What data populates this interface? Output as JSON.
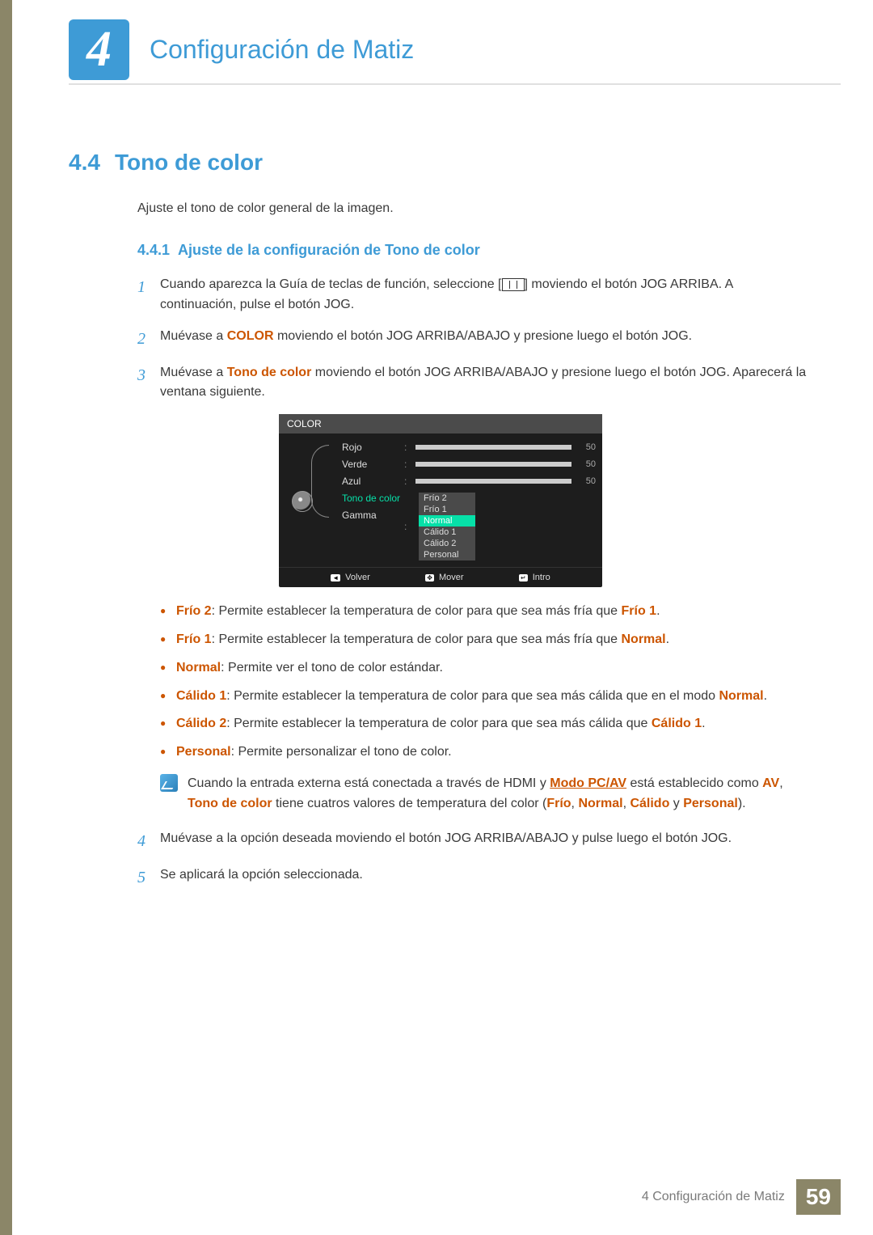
{
  "header": {
    "chapter_number": "4",
    "chapter_title": "Configuración de Matiz"
  },
  "section": {
    "number": "4.4",
    "title": "Tono de color",
    "intro": "Ajuste el tono de color general de la imagen."
  },
  "subsection": {
    "number": "4.4.1",
    "title": "Ajuste de la configuración de Tono de color"
  },
  "steps": {
    "s1": {
      "num": "1",
      "t1": "Cuando aparezca la Guía de teclas de función, seleccione [",
      "t2": "] moviendo el botón JOG ARRIBA. A continuación, pulse el botón JOG."
    },
    "s2": {
      "num": "2",
      "t1": "Muévase a ",
      "k1": "COLOR",
      "t2": " moviendo el botón JOG ARRIBA/ABAJO y presione luego el botón JOG."
    },
    "s3": {
      "num": "3",
      "t1": "Muévase a ",
      "k1": "Tono de color",
      "t2": " moviendo el botón JOG ARRIBA/ABAJO y presione luego el botón JOG. Aparecerá la ventana siguiente."
    },
    "s4": {
      "num": "4",
      "t1": "Muévase a la opción deseada moviendo el botón JOG ARRIBA/ABAJO y pulse luego el botón JOG."
    },
    "s5": {
      "num": "5",
      "t1": "Se aplicará la opción seleccionada."
    }
  },
  "osd": {
    "title": "COLOR",
    "labels": {
      "rojo": "Rojo",
      "verde": "Verde",
      "azul": "Azul",
      "tono": "Tono de color",
      "gamma": "Gamma"
    },
    "values": {
      "rojo": "50",
      "verde": "50",
      "azul": "50"
    },
    "options": {
      "frio2": "Frío 2",
      "frio1": "Frío 1",
      "normal": "Normal",
      "calido1": "Cálido 1",
      "calido2": "Cálido 2",
      "personal": "Personal"
    },
    "footer": {
      "volver": "Volver",
      "mover": "Mover",
      "intro": "Intro",
      "k1": "◄",
      "k2": "✥",
      "k3": "↵"
    }
  },
  "bullets": {
    "b1": {
      "k": "Frío 2",
      "t": ": Permite establecer la temperatura de color para que sea más fría que ",
      "k2": "Frío 1",
      "end": "."
    },
    "b2": {
      "k": "Frío 1",
      "t": ": Permite establecer la temperatura de color para que sea más fría que ",
      "k2": "Normal",
      "end": "."
    },
    "b3": {
      "k": "Normal",
      "t": ": Permite ver el tono de color estándar."
    },
    "b4": {
      "k": "Cálido 1",
      "t": ": Permite establecer la temperatura de color para que sea más cálida que en el modo ",
      "k2": "Normal",
      "end": "."
    },
    "b5": {
      "k": "Cálido 2",
      "t": ": Permite establecer la temperatura de color para que sea más cálida que ",
      "k2": "Cálido 1",
      "end": "."
    },
    "b6": {
      "k": "Personal",
      "t": ": Permite personalizar el tono de color."
    }
  },
  "note": {
    "t1": "Cuando la entrada externa está conectada a través de HDMI y ",
    "k1": "Modo PC/AV",
    "t2": " está establecido como ",
    "k2": "AV",
    "t3": ", ",
    "k3": "Tono de color",
    "t4": " tiene cuatros valores de temperatura del color (",
    "k4": "Frío",
    "t5": ", ",
    "k5": "Normal",
    "t6": ", ",
    "k6": "Cálido",
    "t7": " y ",
    "k7": "Personal",
    "t8": ")."
  },
  "footer": {
    "text": "4 Configuración de Matiz",
    "page": "59"
  }
}
